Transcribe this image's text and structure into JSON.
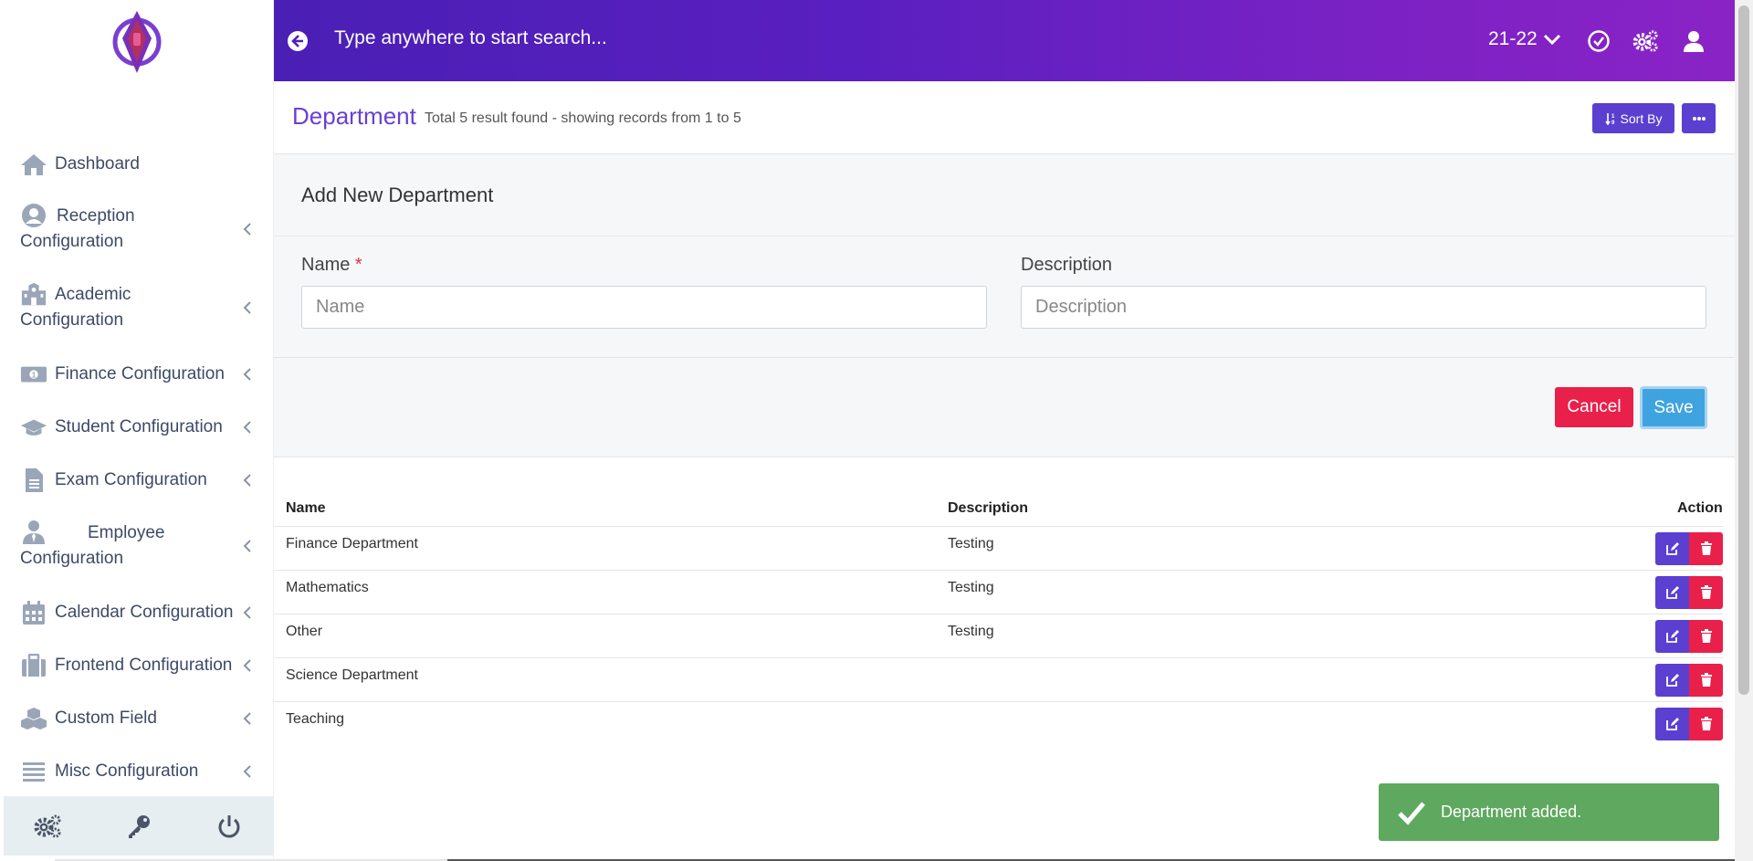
{
  "topbar": {
    "search_placeholder": "Type anywhere to start search...",
    "session": "21-22"
  },
  "sidebar": {
    "items": [
      {
        "label": "Dashboard",
        "icon": "home-icon"
      },
      {
        "label": "Reception Configuration",
        "icon": "user-circle-icon"
      },
      {
        "label": "Academic Configuration",
        "icon": "school-icon"
      },
      {
        "label": "Finance Configuration",
        "icon": "money-icon"
      },
      {
        "label": "Student Configuration",
        "icon": "graduation-cap-icon"
      },
      {
        "label": "Exam Configuration",
        "icon": "file-icon"
      },
      {
        "label": "Employee Configuration",
        "icon": "user-tie-icon"
      },
      {
        "label": "Calendar Configuration",
        "icon": "calendar-icon"
      },
      {
        "label": "Frontend Configuration",
        "icon": "suitcase-icon"
      },
      {
        "label": "Custom Field",
        "icon": "cubes-icon"
      },
      {
        "label": "Misc Configuration",
        "icon": "bars-icon"
      }
    ]
  },
  "page": {
    "title": "Department",
    "subtitle": "Total 5 result found - showing records from 1 to 5",
    "sort_label": "Sort By"
  },
  "form": {
    "title": "Add New Department",
    "name_label": "Name",
    "name_required": "*",
    "name_placeholder": "Name",
    "name_value": "",
    "description_label": "Description",
    "description_placeholder": "Description",
    "description_value": "",
    "cancel_label": "Cancel",
    "save_label": "Save"
  },
  "table": {
    "headers": {
      "name": "Name",
      "description": "Description",
      "action": "Action"
    },
    "rows": [
      {
        "name": "Finance Department",
        "description": "Testing"
      },
      {
        "name": "Mathematics",
        "description": "Testing"
      },
      {
        "name": "Other",
        "description": "Testing"
      },
      {
        "name": "Science Department",
        "description": ""
      },
      {
        "name": "Teaching",
        "description": ""
      }
    ]
  },
  "toast": {
    "message": "Department added.",
    "color": "#5fa85f"
  },
  "colors": {
    "primary": "#5b3fd0",
    "danger": "#e8204a",
    "info": "#3fa3e0",
    "header_gradient_start": "#4a1fb5",
    "header_gradient_end": "#8a23c6"
  }
}
